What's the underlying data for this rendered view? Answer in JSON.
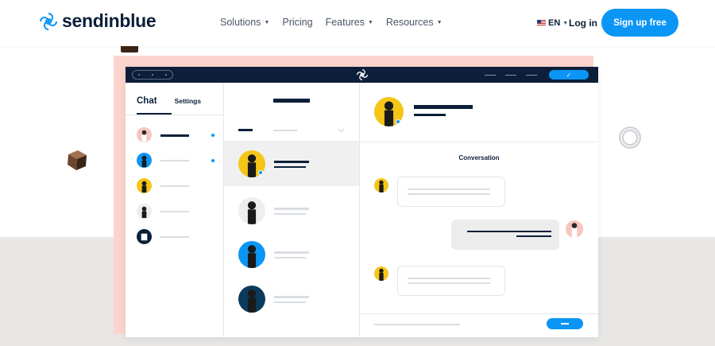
{
  "brand": {
    "name": "sendinblue",
    "logo_icon": "sendinblue-swirl-icon"
  },
  "nav": {
    "links": [
      {
        "label": "Solutions",
        "has_dropdown": true
      },
      {
        "label": "Pricing",
        "has_dropdown": false
      },
      {
        "label": "Features",
        "has_dropdown": true
      },
      {
        "label": "Resources",
        "has_dropdown": true
      }
    ],
    "language": {
      "code": "EN",
      "flag_icon": "us-flag-icon"
    },
    "login_label": "Log in",
    "signup_label": "Sign up free"
  },
  "illustration": {
    "titlebar": {
      "confirm_icon": "checkmark-icon",
      "confirm_glyph": "✓"
    },
    "chat_panel": {
      "tabs": [
        {
          "label": "Chat",
          "active": true
        },
        {
          "label": "Settings",
          "active": false
        }
      ],
      "filter_chevron": "⌵"
    },
    "conversation": {
      "title": "Conversation"
    }
  },
  "colors": {
    "brand_blue": "#0b96f5",
    "navy": "#0b1f3a",
    "pink": "#fbd5cd"
  }
}
